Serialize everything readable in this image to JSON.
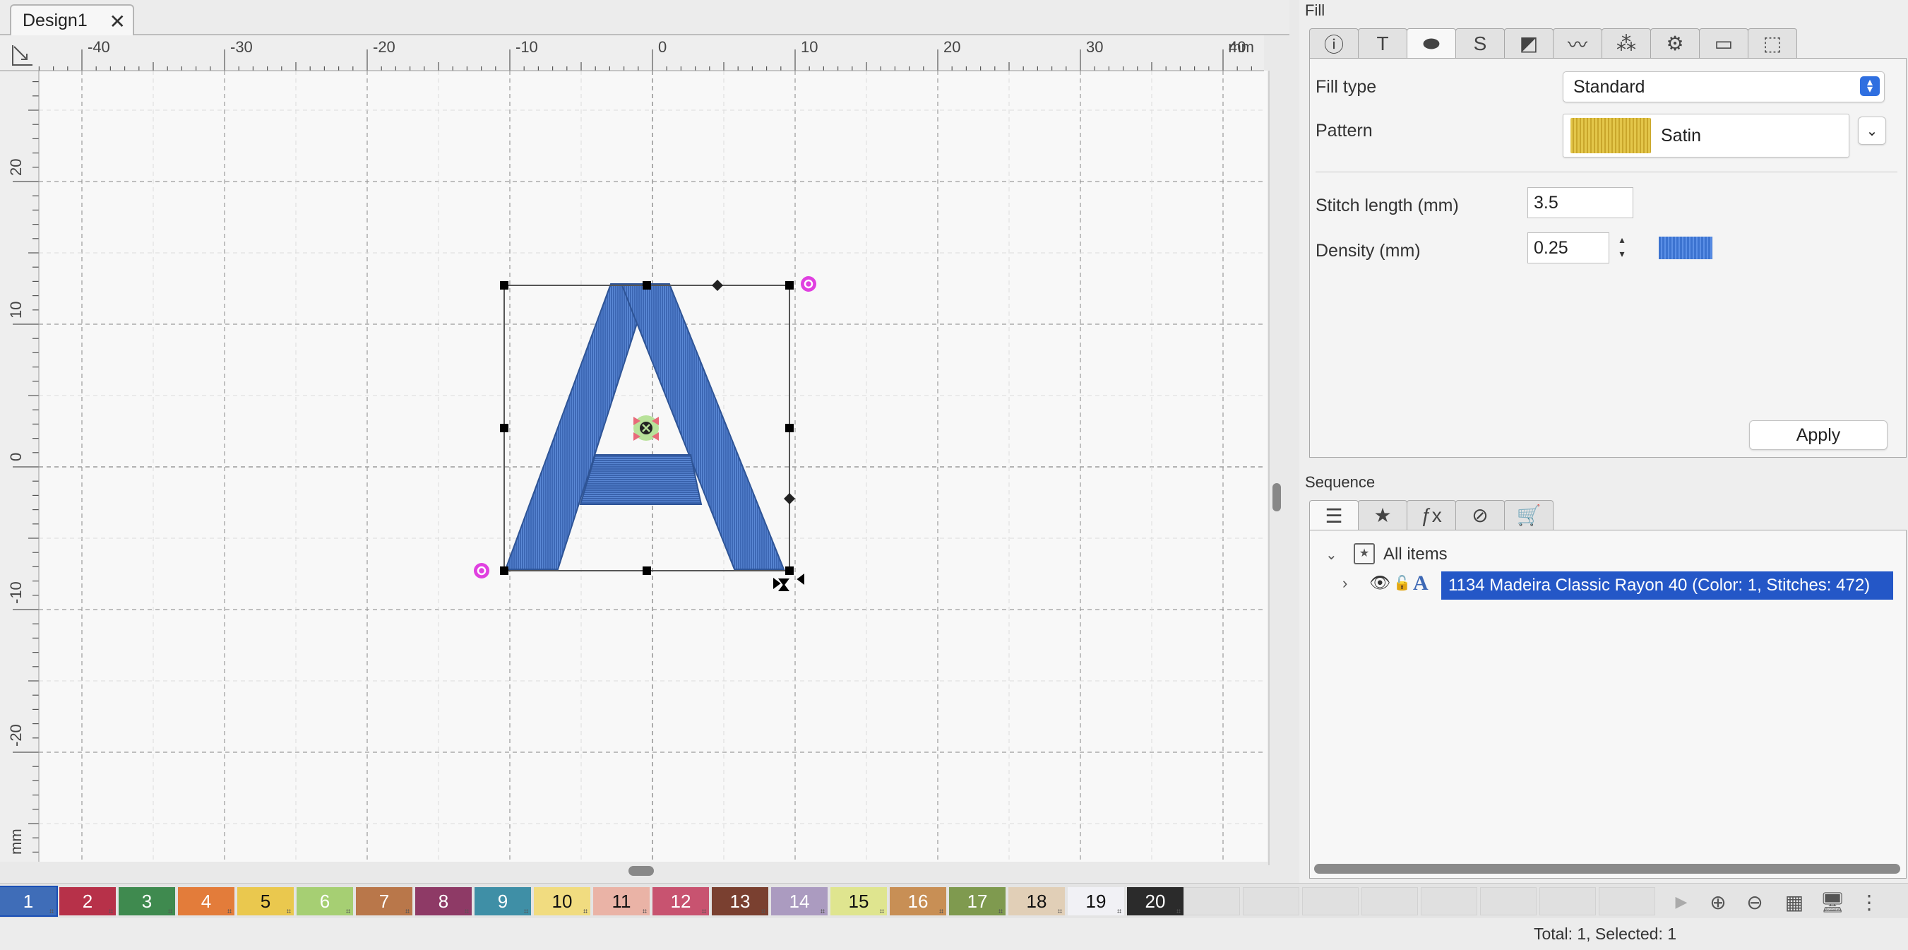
{
  "document_tab": {
    "title": "Design1",
    "close_glyph": "✕"
  },
  "rulers": {
    "unit": "mm",
    "x_ticks": [
      "-40",
      "-30",
      "-20",
      "-10",
      "0",
      "10",
      "20",
      "30",
      "40"
    ],
    "y_ticks": [
      "20",
      "10",
      "0",
      "-10",
      "-20"
    ]
  },
  "design_object": {
    "glyph": "A",
    "thread_color": "#3d68b5"
  },
  "fill_panel": {
    "title": "Fill",
    "tabs": [
      "info-icon",
      "text-icon",
      "fill-icon",
      "stroke-icon",
      "color-fill-icon",
      "effect-icon",
      "stitch-icon",
      "settings-icon",
      "comment-icon",
      "resize-icon"
    ],
    "fill_type_label": "Fill type",
    "fill_type_value": "Standard",
    "pattern_label": "Pattern",
    "pattern_value": "Satin",
    "stitch_length_label": "Stitch length (mm)",
    "stitch_length_value": "3.5",
    "density_label": "Density (mm)",
    "density_value": "0.25",
    "apply_label": "Apply"
  },
  "sequence_panel": {
    "title": "Sequence",
    "tabs": [
      "list-icon",
      "star-icon",
      "fx-icon",
      "compass-icon",
      "cart-icon"
    ],
    "root_label": "All items",
    "item_label": "1134 Madeira Classic Rayon 40 (Color: 1, Stitches: 472)"
  },
  "color_palette": [
    {
      "label": "1",
      "color": "#3f6db8",
      "text": "#ffffff"
    },
    {
      "label": "2",
      "color": "#b73149",
      "text": "#ffffff"
    },
    {
      "label": "3",
      "color": "#3f8a4f",
      "text": "#ffffff"
    },
    {
      "label": "4",
      "color": "#e37c3a",
      "text": "#ffffff"
    },
    {
      "label": "5",
      "color": "#eac84e",
      "text": "#111111"
    },
    {
      "label": "6",
      "color": "#a6cf73",
      "text": "#ffffff"
    },
    {
      "label": "7",
      "color": "#b9774a",
      "text": "#ffffff"
    },
    {
      "label": "8",
      "color": "#8e3a66",
      "text": "#ffffff"
    },
    {
      "label": "9",
      "color": "#3f8fa6",
      "text": "#ffffff"
    },
    {
      "label": "10",
      "color": "#f1dc80",
      "text": "#111111"
    },
    {
      "label": "11",
      "color": "#eab3a6",
      "text": "#111111"
    },
    {
      "label": "12",
      "color": "#c85370",
      "text": "#ffffff"
    },
    {
      "label": "13",
      "color": "#7a4030",
      "text": "#ffffff"
    },
    {
      "label": "14",
      "color": "#ab9bc0",
      "text": "#ffffff"
    },
    {
      "label": "15",
      "color": "#dfe58f",
      "text": "#111111"
    },
    {
      "label": "16",
      "color": "#c88f55",
      "text": "#ffffff"
    },
    {
      "label": "17",
      "color": "#7f9a4f",
      "text": "#ffffff"
    },
    {
      "label": "18",
      "color": "#e1cfb7",
      "text": "#111111"
    },
    {
      "label": "19",
      "color": "#f1f1f5",
      "text": "#111111"
    },
    {
      "label": "20",
      "color": "#2b2b2b",
      "text": "#ffffff"
    }
  ],
  "colorbar_icons": [
    "play-icon",
    "add-color-icon",
    "remove-color-icon",
    "palette-grid-icon",
    "monitor-icon",
    "more-icon"
  ],
  "status": {
    "text": "Total: 1, Selected: 1"
  }
}
